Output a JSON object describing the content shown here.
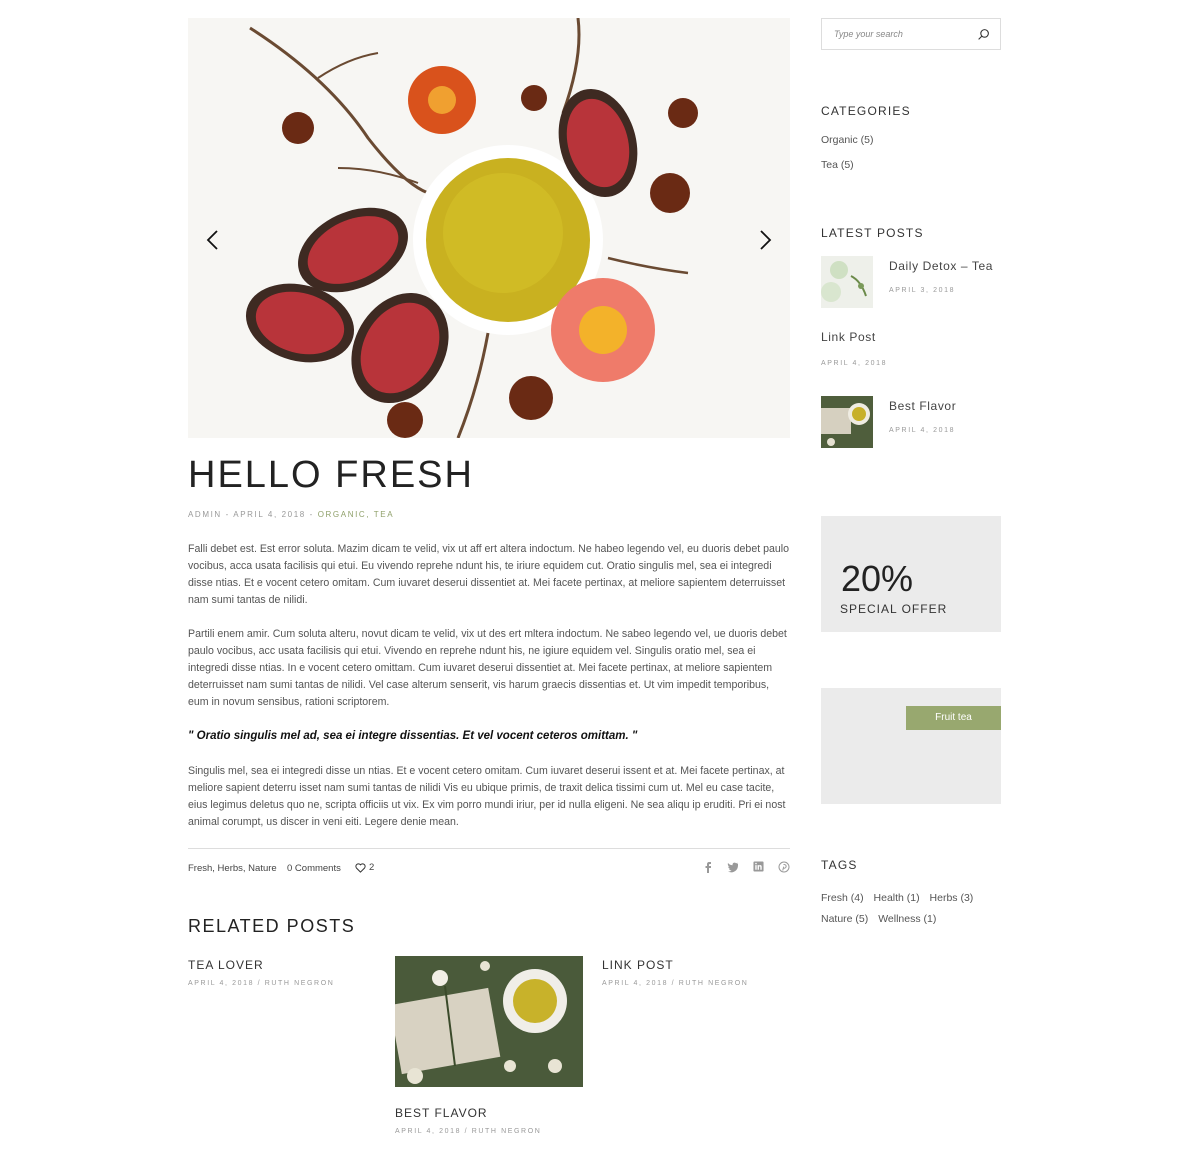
{
  "post": {
    "title": "HELLO FRESH",
    "meta_author": "ADMIN",
    "meta_date": "APRIL 4, 2018",
    "meta_categories": "ORGANIC, TEA",
    "paragraphs": [
      "Falli debet est. Est error soluta. Mazim dicam te velid, vix ut aff ert altera indoctum. Ne habeo legendo vel, eu duoris debet paulo vocibus, acca usata facilisis qui etui. Eu vivendo reprehe ndunt his, te iriure equidem cut. Oratio singulis mel, sea ei integredi disse ntias. Et e vocent cetero omitam. Cum iuvaret deserui dissentiet at. Mei facete pertinax, at meliore sapientem deterruisset nam sumi tantas de nilidi.",
      "Partili enem amir. Cum soluta alteru, novut dicam te velid, vix ut des ert mltera indoctum. Ne sabeo legendo vel, ue duoris debet paulo vocibus, acc usata facilisis qui etui. Vivendo en reprehe ndunt his, ne igiure equidem vel. Singulis oratio mel, sea ei integredi disse ntias. In e vocent cetero omittam. Cum iuvaret deserui dissentiet at. Mei facete pertinax, at meliore sapientem deterruisset nam sumi tantas de nilidi. Vel case alterum senserit, vis harum graecis dissentias et. Ut vim impedit temporibus, eum in novum sensibus, rationi scriptorem.",
      "Singulis mel, sea ei integredi disse un ntias. Et e vocent cetero omitam. Cum iuvaret deserui issent et at. Mei facete pertinax, at meliore sapient deterru isset nam sumi tantas de nilidi Vis eu ubique primis, de traxit delica tissimi cum ut. Mel eu case tacite, eius legimus deletus quo ne, scripta officiis ut vix. Ex vim porro mundi iriur, per id nulla eligeni. Ne sea aliqu ip eruditi. Pri ei nost animal corumpt, us discer in veni eiti. Legere denie mean."
    ],
    "quote": "\" Oratio singulis mel ad, sea ei integre dissentias. Et vel vocent ceteros omittam. \"",
    "footer_tags": "Fresh, Herbs, Nature",
    "footer_comments": "0 Comments",
    "footer_likes": "2"
  },
  "icons": {
    "prev": "chevron-left-icon",
    "next": "chevron-right-icon",
    "search": "search-icon",
    "heart": "heart-icon",
    "share": [
      "facebook-icon",
      "twitter-icon",
      "linkedin-icon",
      "pinterest-icon"
    ]
  },
  "related": {
    "title": "RELATED POSTS",
    "posts": [
      {
        "title": "TEA LOVER",
        "meta": "APRIL 4, 2018 / RUTH NEGRON"
      },
      {
        "title": "BEST FLAVOR",
        "meta": "APRIL 4, 2018 / RUTH NEGRON"
      },
      {
        "title": "LINK POST",
        "meta": "APRIL 4, 2018 / RUTH NEGRON"
      }
    ]
  },
  "sidebar": {
    "search_placeholder": "Type your search",
    "categories_title": "CATEGORIES",
    "categories": [
      "Organic (5)",
      "Tea (5)"
    ],
    "latest_title": "LATEST POSTS",
    "latest": [
      {
        "title": "Daily Detox – Tea",
        "date": "APRIL 3, 2018"
      },
      {
        "title": "Link Post",
        "date": "APRIL 4, 2018"
      },
      {
        "title": "Best Flavor",
        "date": "APRIL 4, 2018"
      }
    ],
    "offer_percent": "20%",
    "offer_label": "SPECIAL OFFER",
    "banner_tag": "Fruit tea",
    "tags_title": "TAGS",
    "tags": [
      "Fresh (4)",
      "Health (1)",
      "Herbs (3)",
      "Nature (5)",
      "Wellness (1)"
    ]
  },
  "colors": {
    "accent": "#98a86f",
    "offer_bg": "#ebebeb"
  }
}
